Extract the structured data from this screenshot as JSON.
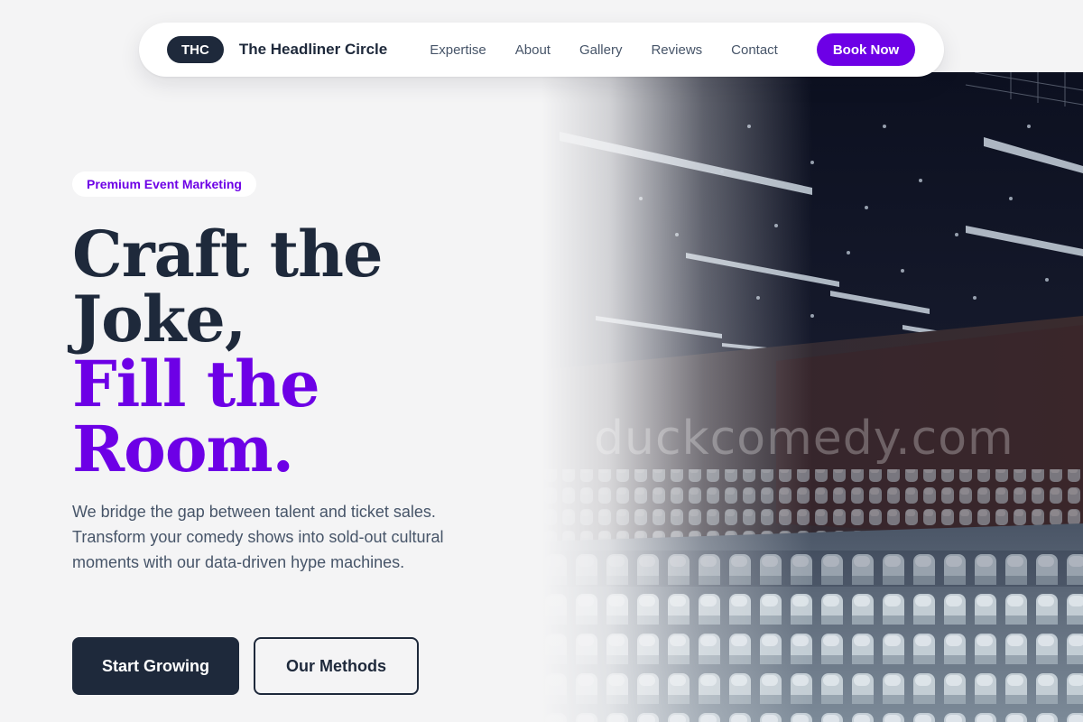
{
  "nav": {
    "logo_badge": "THC",
    "brand_name": "The Headliner Circle",
    "links": [
      "Expertise",
      "About",
      "Gallery",
      "Reviews",
      "Contact"
    ],
    "cta": "Book Now"
  },
  "hero": {
    "eyebrow": "Premium Event Marketing",
    "headline_line1": "Craft the",
    "headline_line2": "Joke,",
    "headline_line3": "Fill the",
    "headline_line4": "Room.",
    "subtext": "We bridge the gap between talent and ticket sales. Transform your comedy shows into sold-out cultural moments with our data-driven hype machines.",
    "primary_button": "Start Growing",
    "secondary_button": "Our Methods",
    "image_watermark": "duckcomedy.com"
  },
  "colors": {
    "accent": "#6d00e6",
    "dark": "#1e293b",
    "muted_text": "#475569",
    "background": "#f4f4f5"
  }
}
